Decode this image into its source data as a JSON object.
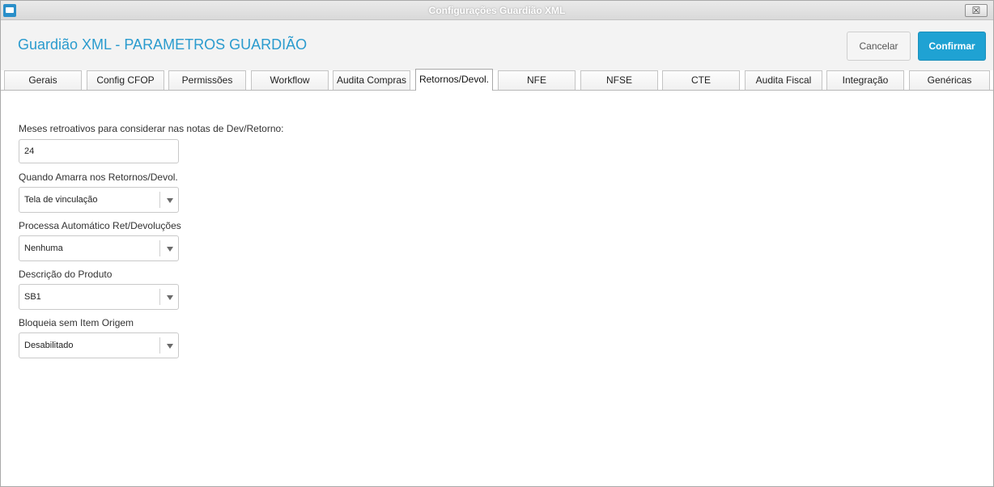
{
  "window": {
    "title": "Configurações Guardião XML",
    "close_icon": "close-icon",
    "close_glyph": "☒"
  },
  "header": {
    "title": "Guardião XML - PARAMETROS GUARDIÃO",
    "cancel_label": "Cancelar",
    "confirm_label": "Confirmar",
    "accent_color": "#1fa2d3"
  },
  "tabs": [
    {
      "label": "Gerais"
    },
    {
      "label": "Config CFOP"
    },
    {
      "label": "Permissões"
    },
    {
      "label": "Workflow"
    },
    {
      "label": "Audita Compras"
    },
    {
      "label": "Retornos/Devol.",
      "active": true
    },
    {
      "label": "NFE"
    },
    {
      "label": "NFSE"
    },
    {
      "label": "CTE"
    },
    {
      "label": "Audita Fiscal"
    },
    {
      "label": "Integração"
    },
    {
      "label": "Genéricas"
    }
  ],
  "form": {
    "meses": {
      "label": "Meses retroativos para considerar nas notas de Dev/Retorno:",
      "value": "24"
    },
    "amarra": {
      "label": "Quando Amarra nos Retornos/Devol.",
      "value": "Tela de vinculação"
    },
    "processa": {
      "label": "Processa Automático Ret/Devoluções",
      "value": "Nenhuma"
    },
    "descricao": {
      "label": "Descrição do Produto",
      "value": "SB1"
    },
    "bloqueia": {
      "label": "Bloqueia sem Item Origem",
      "value": "Desabilitado"
    }
  }
}
